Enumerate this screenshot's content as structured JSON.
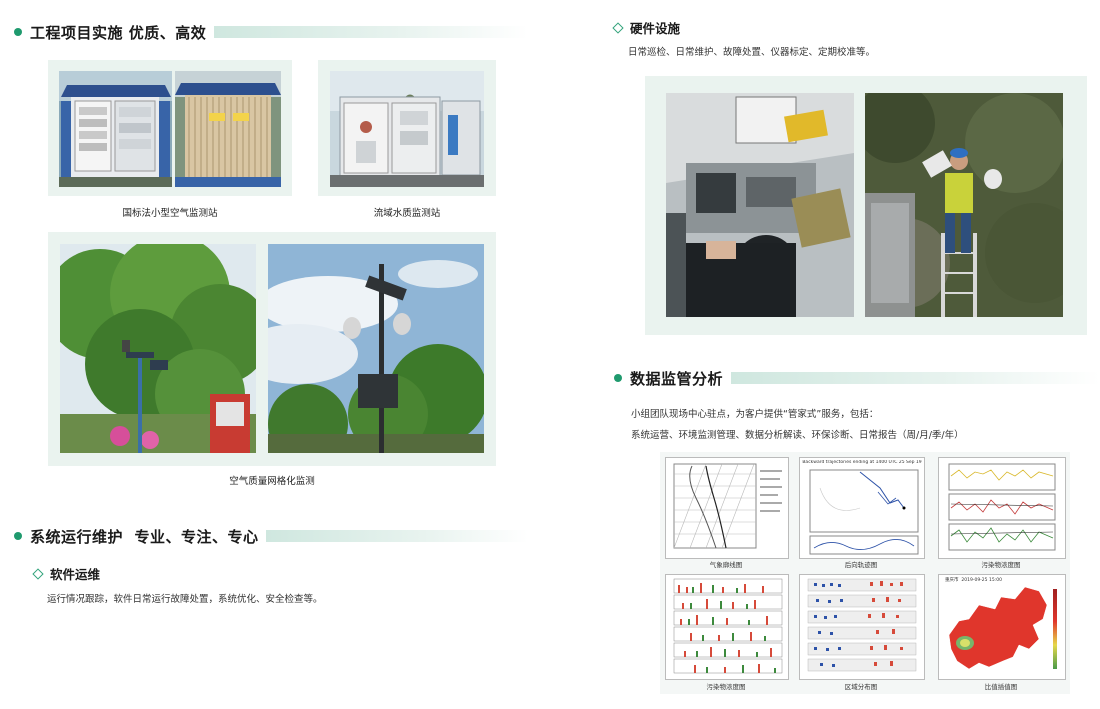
{
  "left": {
    "section1_title": "工程项目实施 优质、高效",
    "captions": {
      "air_station": "国标法小型空气监测站",
      "water_station": "流域水质监测站",
      "grid": "空气质量网格化监测"
    },
    "section2_title": "系统运行维护  专业、专注、专心",
    "software": {
      "title": "软件运维",
      "desc": "运行情况跟踪，软件日常运行故障处置，系统优化、安全检查等。"
    }
  },
  "right": {
    "hardware": {
      "title": "硬件设施",
      "desc": "日常巡检、日常维护、故障处置、仪器标定、定期校准等。"
    },
    "section3_title": "数据监管分析",
    "desc1": "小组团队现场中心驻点，为客户提供“管家式”服务，包括：",
    "desc2": "系统运营、环境监测管理、数据分析解读、环保诊断、日常报告（周/月/季/年）",
    "charts": [
      {
        "caption": "气象廓线图"
      },
      {
        "caption": "后向轨迹图"
      },
      {
        "caption": "污染物浓度图"
      },
      {
        "caption": "污染物浓度图"
      },
      {
        "caption": "区域分布图"
      },
      {
        "caption": "比值插值图"
      }
    ],
    "mini_titles": {
      "trajectory": "Backward trajectories ending at 1400 UTC 25 Sep 19",
      "map_label": "重庆市",
      "map_date": "2019-09-25 15:00"
    }
  },
  "colors": {
    "accent": "#1f9a6e",
    "panel": "#eaf3ef"
  }
}
